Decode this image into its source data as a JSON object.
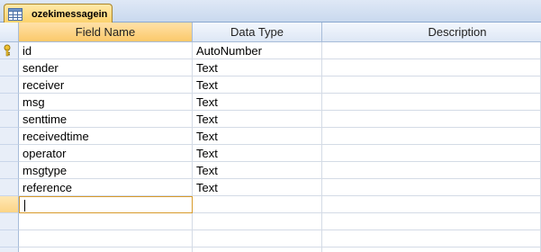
{
  "tab": {
    "title": "ozekimessagein",
    "icon": "table-icon"
  },
  "columns": [
    "Field Name",
    "Data Type",
    "Description"
  ],
  "fields": [
    {
      "name": "id",
      "type": "AutoNumber",
      "primary_key": true
    },
    {
      "name": "sender",
      "type": "Text"
    },
    {
      "name": "receiver",
      "type": "Text"
    },
    {
      "name": "msg",
      "type": "Text"
    },
    {
      "name": "senttime",
      "type": "Text"
    },
    {
      "name": "receivedtime",
      "type": "Text"
    },
    {
      "name": "operator",
      "type": "Text"
    },
    {
      "name": "msgtype",
      "type": "Text"
    },
    {
      "name": "reference",
      "type": "Text"
    }
  ],
  "colors": {
    "accent": "#fbd16a",
    "grid_line": "#d4dbe6",
    "header": "#dde7f5"
  }
}
